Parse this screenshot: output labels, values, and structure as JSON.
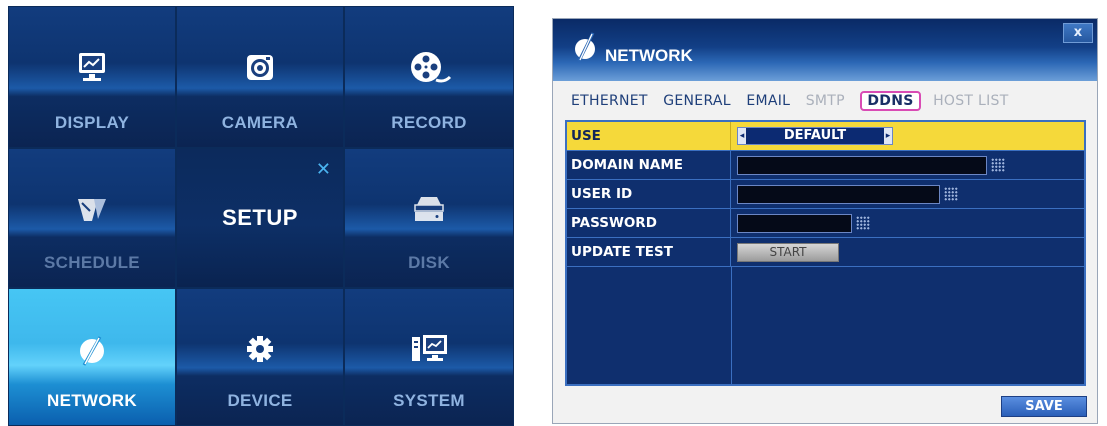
{
  "setup_menu": {
    "title": "SETUP",
    "tiles": [
      {
        "label": "DISPLAY",
        "icon": "display-icon"
      },
      {
        "label": "CAMERA",
        "icon": "camera-icon"
      },
      {
        "label": "RECORD",
        "icon": "film-reel-icon"
      },
      {
        "label": "SCHEDULE",
        "icon": "schedule-icon"
      },
      {
        "label": "DISK",
        "icon": "disk-icon"
      },
      {
        "label": "NETWORK",
        "icon": "network-icon"
      },
      {
        "label": "DEVICE",
        "icon": "gear-icon"
      },
      {
        "label": "SYSTEM",
        "icon": "system-icon"
      }
    ],
    "close_symbol": "✕",
    "active": "NETWORK"
  },
  "network_dialog": {
    "title": "NETWORK",
    "close_label": "x",
    "tabs": [
      {
        "label": "ETHERNET",
        "state": "enabled"
      },
      {
        "label": "GENERAL",
        "state": "enabled"
      },
      {
        "label": "EMAIL",
        "state": "enabled"
      },
      {
        "label": "SMTP",
        "state": "disabled"
      },
      {
        "label": "DDNS",
        "state": "active"
      },
      {
        "label": "HOST LIST",
        "state": "disabled"
      }
    ],
    "rows": {
      "use": {
        "label": "USE",
        "value": "DEFAULT"
      },
      "domain_name": {
        "label": "DOMAIN NAME",
        "value": ""
      },
      "user_id": {
        "label": "USER ID",
        "value": ""
      },
      "password": {
        "label": "PASSWORD",
        "value": ""
      },
      "update_test": {
        "label": "UPDATE TEST",
        "button": "START"
      }
    },
    "save_label": "SAVE"
  },
  "colors": {
    "accent_selected_row": "#f5d93a",
    "active_tab_border": "#d94bb4",
    "panel_background": "#0f2f6e",
    "active_tile": "#3eb8ec"
  }
}
